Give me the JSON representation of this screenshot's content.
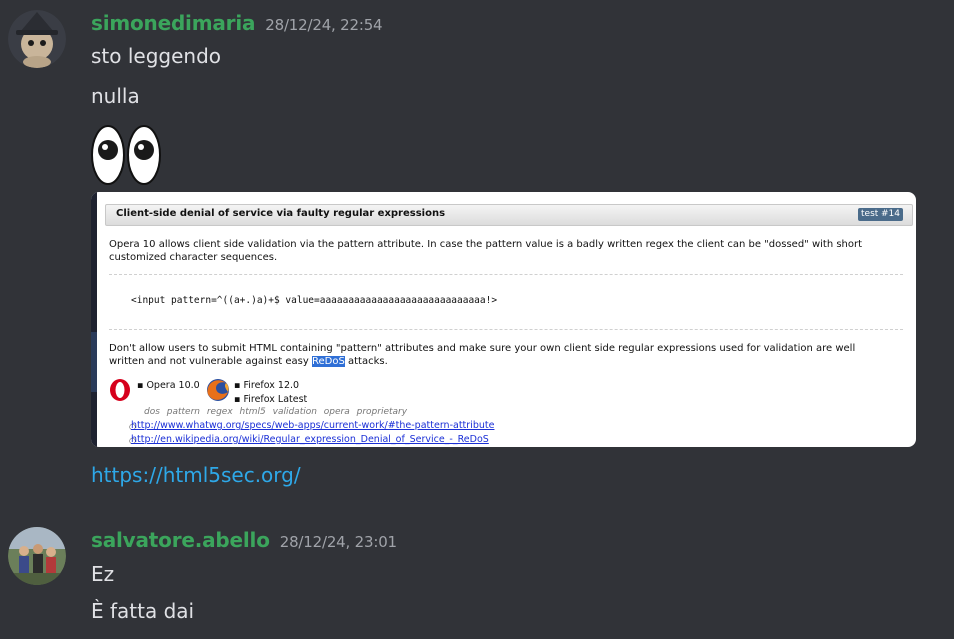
{
  "messages": [
    {
      "username": "simonedimaria",
      "timestamp": "28/12/24, 22:54",
      "lines": [
        "sto leggendo",
        "nulla"
      ],
      "emoji": "eyes-emoji",
      "embed_image": {
        "title": "Client-side denial of service via faulty regular expressions",
        "tags": [
          "test",
          "#14"
        ],
        "paragraph1_line1": "Opera 10 allows client side validation via the pattern attribute. In case the pattern value is a badly written regex the client can be \"dossed\" with short",
        "paragraph1_line2": "customized character sequences.",
        "code": "<input pattern=^((a+.)a)+$ value=aaaaaaaaaaaaaaaaaaaaaaaaaaaaa!>",
        "paragraph2_line1": "Don't allow users to submit HTML containing \"pattern\" attributes and make sure your own client side regular expressions used for validation are well",
        "paragraph2_line2_before": "written and not vulnerable against easy ",
        "paragraph2_line2_highlight": "ReDoS",
        "paragraph2_line2_after": " attacks.",
        "browsers": [
          {
            "name": "Opera",
            "items": [
              "▪ Opera 10.0"
            ]
          },
          {
            "name": "Firefox",
            "items": [
              "▪ Firefox 12.0",
              "▪ Firefox Latest"
            ]
          }
        ],
        "keywords": "dos  pattern  regex  html5  validation  opera  proprietary",
        "links": [
          "http://www.whatwg.org/specs/web-apps/current-work/#the-pattern-attribute",
          "http://en.wikipedia.org/wiki/Regular_expression_Denial_of_Service_-_ReDoS"
        ]
      },
      "link": "https://html5sec.org/"
    },
    {
      "username": "salvatore.abello",
      "timestamp": "28/12/24, 23:01",
      "lines": [
        "Ez",
        "È fatta dai"
      ]
    }
  ],
  "colors": {
    "background": "#313338",
    "username": "#3ba55c",
    "text": "#e0e1e5",
    "timestamp": "#a0a3a9",
    "link": "#2ea8e8"
  }
}
